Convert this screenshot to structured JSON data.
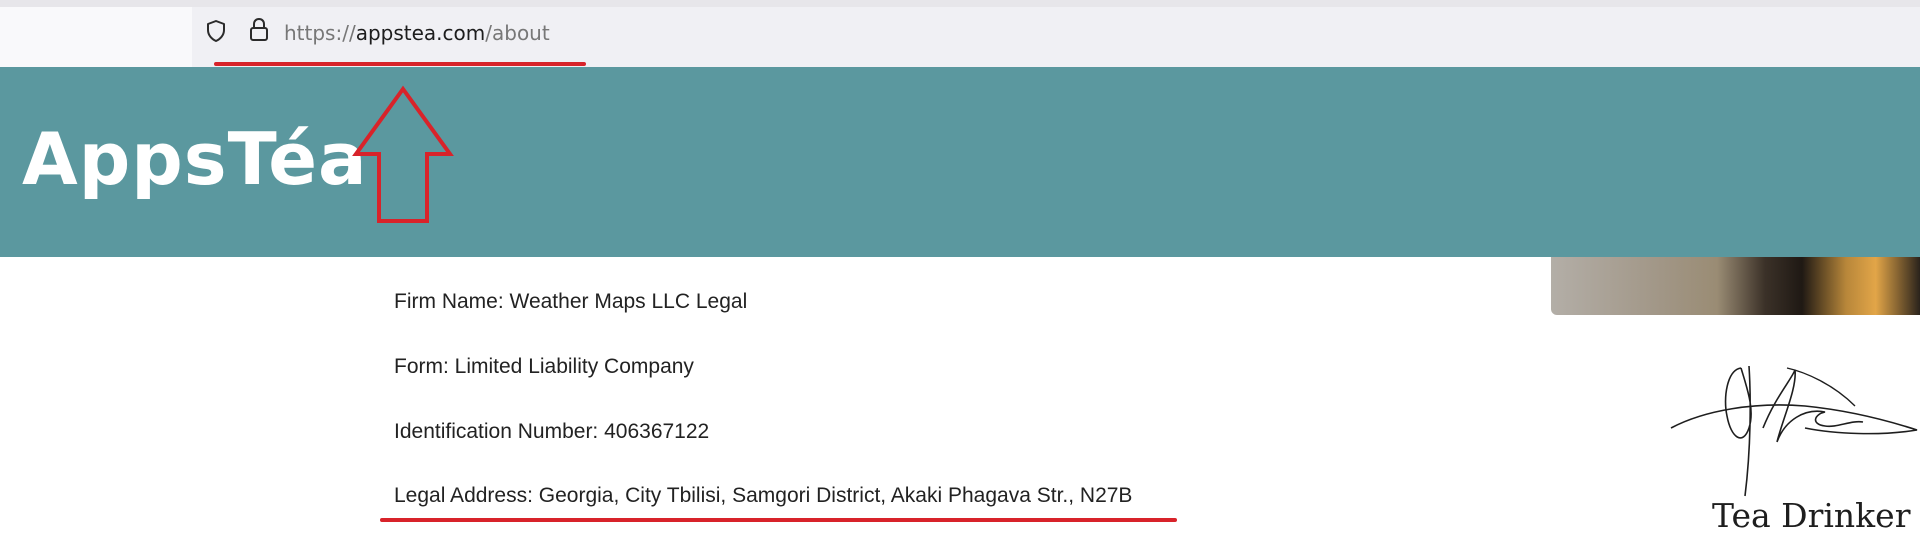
{
  "browser": {
    "url_scheme": "https://",
    "url_domain": "appstea.com",
    "url_path": "/about",
    "icons": [
      "shield-icon",
      "lock-icon"
    ]
  },
  "header": {
    "logo_text": "AppsTéa",
    "background_color": "#5b989f",
    "annotation": "up-arrow-icon"
  },
  "company": {
    "firm_name": "Firm Name: Weather Maps LLC Legal",
    "form": "Form: Limited Liability Company",
    "identification": "Identification Number: 406367122",
    "legal_address": "Legal Address: Georgia, City Tbilisi, Samgori District, Akaki Phagava Str., N27B"
  },
  "signature": {
    "name": "Tea Drinker"
  },
  "annotation_color": "#d8232a"
}
